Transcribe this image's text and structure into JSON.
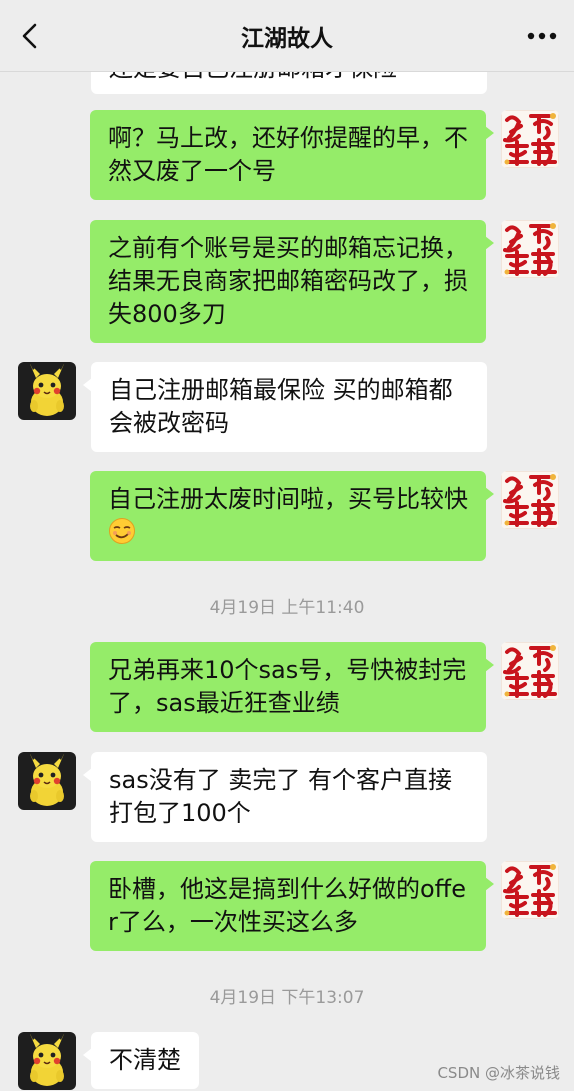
{
  "header": {
    "title": "江湖故人",
    "back_icon": "chevron-left-icon",
    "more_icon": "more-dots-icon"
  },
  "messages": {
    "m0": {
      "text": "还是要自己注册邮箱才保险",
      "from": "them"
    },
    "m1": {
      "text": "啊？马上改，还好你提醒的早，不然又废了一个号",
      "from": "me"
    },
    "m2": {
      "text": "之前有个账号是买的邮箱忘记换，结果无良商家把邮箱密码改了，损失800多刀",
      "from": "me"
    },
    "m3": {
      "text": "自己注册邮箱最保险 买的邮箱都会被改密码",
      "from": "them"
    },
    "m4": {
      "text": "自己注册太废时间啦，买号比较快",
      "from": "me",
      "emoji": "smirk-emoji-icon"
    },
    "m5": {
      "text": "兄弟再来10个sas号，号快被封完了，sas最近狂查业绩",
      "from": "me"
    },
    "m6": {
      "text": "sas没有了 卖完了 有个客户直接打包了100个",
      "from": "them"
    },
    "m7": {
      "text": "卧槽，他这是搞到什么好做的offer了么，一次性买这么多",
      "from": "me"
    },
    "m8": {
      "text": "不清楚",
      "from": "them"
    }
  },
  "timestamps": {
    "t1": "4月19日 上午11:40",
    "t2": "4月19日 下午13:07"
  },
  "avatars": {
    "me": {
      "icon": "red-calligraphy-avatar-icon",
      "chars": "进号早备"
    },
    "them": {
      "icon": "pikachu-avatar-icon"
    }
  },
  "watermark": "CSDN @冰茶说钱",
  "colors": {
    "my_bubble": "#95ec69",
    "their_bubble": "#ffffff",
    "background": "#ededed"
  }
}
